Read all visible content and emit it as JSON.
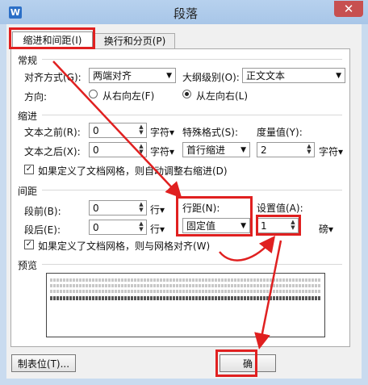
{
  "window": {
    "title": "段落",
    "close_glyph": "✕",
    "app_icon": "W"
  },
  "tabs": [
    {
      "label": "缩进和间距(I)"
    },
    {
      "label": "换行和分页(P)"
    }
  ],
  "general": {
    "section": "常规",
    "align_label": "对齐方式(G):",
    "align_value": "两端对齐",
    "outline_label": "大纲级别(O):",
    "outline_value": "正文文本",
    "direction_label": "方向:",
    "rtl_label": "从右向左(F)",
    "ltr_label": "从左向右(L)"
  },
  "indent": {
    "section": "缩进",
    "before_label": "文本之前(R):",
    "before_value": "0",
    "before_unit": "字符▾",
    "after_label": "文本之后(X):",
    "after_value": "0",
    "after_unit": "字符▾",
    "special_label": "特殊格式(S):",
    "special_value": "首行缩进",
    "by_label": "度量值(Y):",
    "by_value": "2",
    "by_unit": "字符▾",
    "grid_check": "如果定义了文档网格，则自动调整右缩进(D)"
  },
  "spacing": {
    "section": "间距",
    "before_label": "段前(B):",
    "before_value": "0",
    "before_unit": "行▾",
    "after_label": "段后(E):",
    "after_value": "0",
    "after_unit": "行▾",
    "line_label": "行距(N):",
    "line_value": "固定值",
    "at_label": "设置值(A):",
    "at_value": "1",
    "at_unit": "磅▾",
    "grid_check": "如果定义了文档网格，则与网格对齐(W)"
  },
  "preview": {
    "section": "预览"
  },
  "buttons": {
    "tabs": "制表位(T)...",
    "ok": "确"
  },
  "colors": {
    "annotation": "#e02020",
    "accent": "#2b6fc7"
  }
}
